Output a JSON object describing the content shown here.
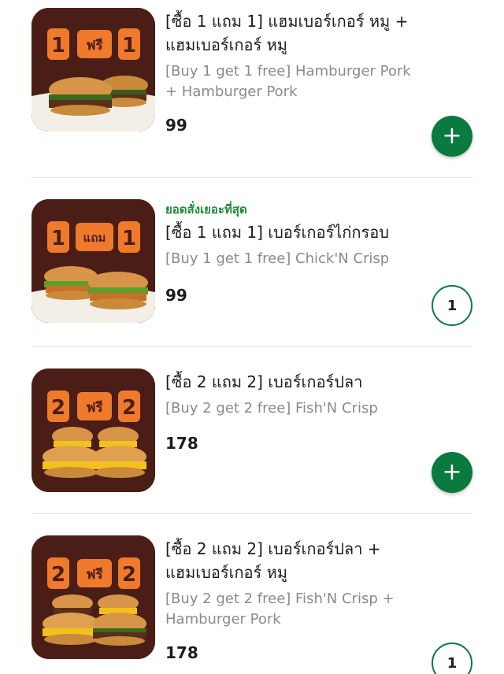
{
  "colors": {
    "accent": "#0a7a3e",
    "tag": "#1f8a3a",
    "thumb_bg": "#4a1e16",
    "badge": "#f07a2c"
  },
  "items": [
    {
      "tag": "",
      "badge_left": "1",
      "badge_mid": "ฟรี",
      "badge_right": "1",
      "title_th": "[ซื้อ 1 แถม 1] แฮมเบอร์เกอร์ หมู + แฮมเบอร์เกอร์ หมู",
      "title_en": "[Buy 1 get 1 free] Hamburger Pork + Hamburger Pork",
      "price": "99",
      "action": "add",
      "action_icon": "plus-icon",
      "quantity": ""
    },
    {
      "tag": "ยอดสั่งเยอะที่สุด",
      "badge_left": "1",
      "badge_mid": "แถม",
      "badge_right": "1",
      "title_th": "[ซื้อ 1 แถม 1] เบอร์เกอร์ไก่กรอบ",
      "title_en": "[Buy 1 get 1 free] Chick'N Crisp",
      "price": "99",
      "action": "quantity",
      "action_icon": "",
      "quantity": "1"
    },
    {
      "tag": "",
      "badge_left": "2",
      "badge_mid": "ฟรี",
      "badge_right": "2",
      "title_th": "[ซื้อ 2 แถม 2] เบอร์เกอร์ปลา",
      "title_en": "[Buy 2 get 2 free] Fish'N Crisp",
      "price": "178",
      "action": "add",
      "action_icon": "plus-icon",
      "quantity": ""
    },
    {
      "tag": "",
      "badge_left": "2",
      "badge_mid": "ฟรี",
      "badge_right": "2",
      "title_th": "[ซื้อ 2 แถม 2] เบอร์เกอร์ปลา + แฮมเบอร์เกอร์ หมู",
      "title_en": "[Buy 2 get 2 free] Fish'N Crisp + Hamburger Pork",
      "price": "178",
      "action": "quantity",
      "action_icon": "",
      "quantity": "1"
    }
  ]
}
